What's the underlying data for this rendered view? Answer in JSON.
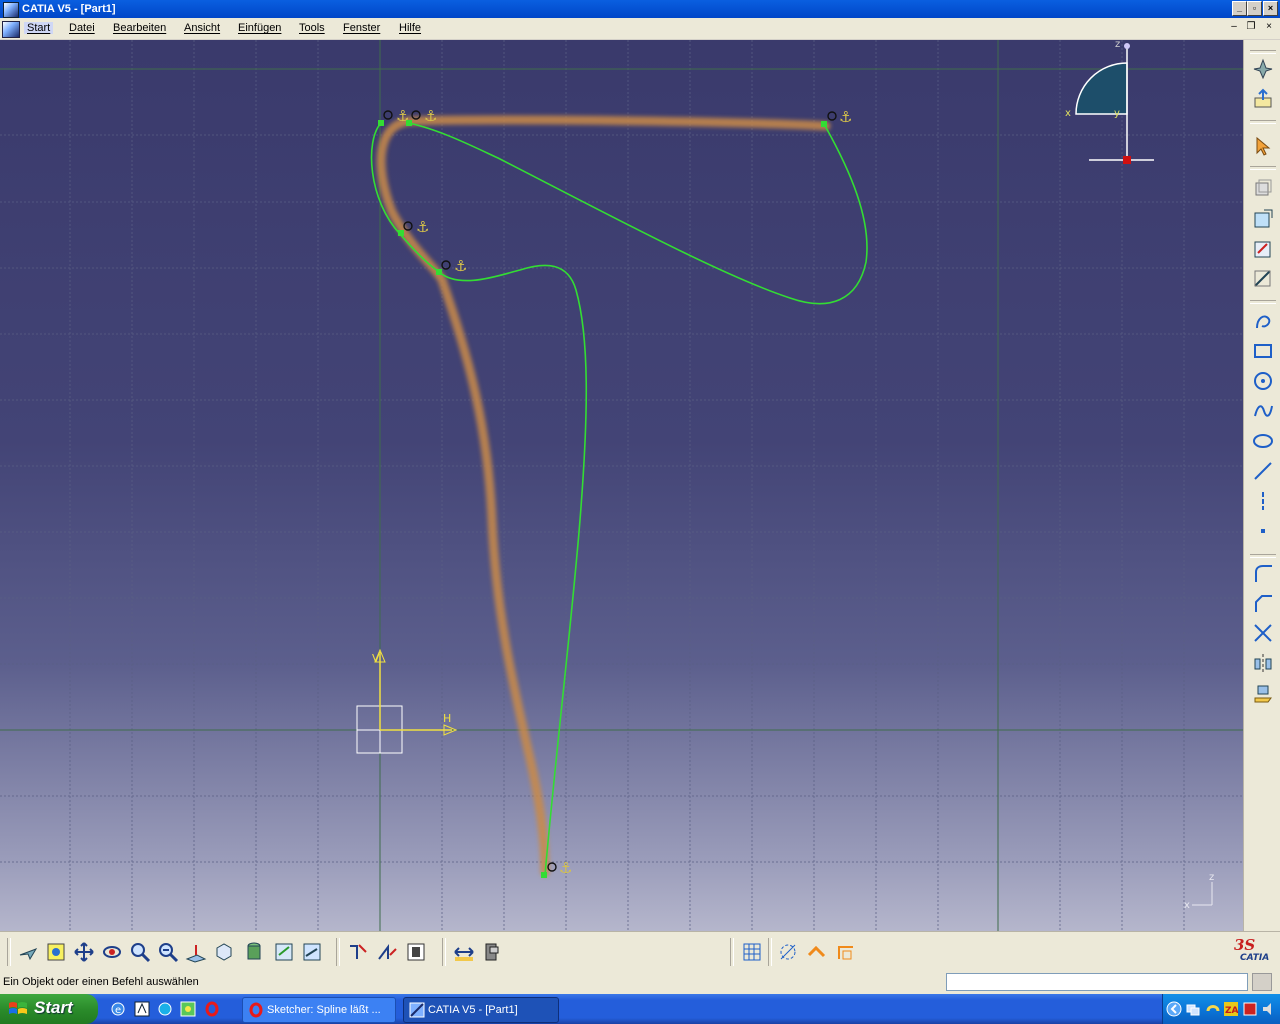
{
  "window": {
    "title": "CATIA V5 - [Part1]"
  },
  "menu": {
    "items": [
      "Start",
      "Datei",
      "Bearbeiten",
      "Ansicht",
      "Einfügen",
      "Tools",
      "Fenster",
      "Hilfe"
    ]
  },
  "viewport": {
    "compass_labels": {
      "z": "z",
      "x": "x",
      "y": "y"
    },
    "axis_labels": {
      "v": "V",
      "h": "H"
    },
    "corner_axes": {
      "x": "x",
      "z": "z"
    }
  },
  "right_toolbar": {
    "icons": [
      "fly-mode-icon",
      "exit-workbench-icon",
      "select-icon",
      "sketch-profile-icon",
      "rectangle-icon",
      "circle-icon",
      "spline-icon",
      "ellipse-icon",
      "line-icon",
      "axis-icon",
      "point-icon",
      "corner-icon",
      "chamfer-icon",
      "trim-icon",
      "mirror-icon",
      "project-3d-icon"
    ]
  },
  "bottom_toolbar": {
    "icons": [
      "fly-icon",
      "fit-all-icon",
      "pan-icon",
      "rotate-icon",
      "zoom-in-icon",
      "zoom-out-icon",
      "normal-view-icon",
      "quick-view-icon",
      "render-style-icon",
      "hide-show-icon",
      "swap-space-icon",
      "sketch-analysis-icon",
      "constraint-icon",
      "animate-constraint-icon",
      "measure-icon",
      "apply-material-icon",
      "grid-icon",
      "snap-point-icon",
      "construction-icon",
      "geometric-constraints-icon"
    ],
    "brand": "CATIA"
  },
  "status": {
    "message": "Ein Objekt oder einen Befehl auswählen",
    "command_value": ""
  },
  "taskbar": {
    "start_label": "Start",
    "tasks": [
      {
        "label": "Sketcher: Spline läßt ...",
        "active": false
      },
      {
        "label": "CATIA V5 - [Part1]",
        "active": true
      }
    ]
  },
  "colors": {
    "spline": "#33dd33",
    "highlight_stroke": "#c98a4a",
    "compass_fill": "#1d4e6a",
    "axis": "#f0e040"
  }
}
